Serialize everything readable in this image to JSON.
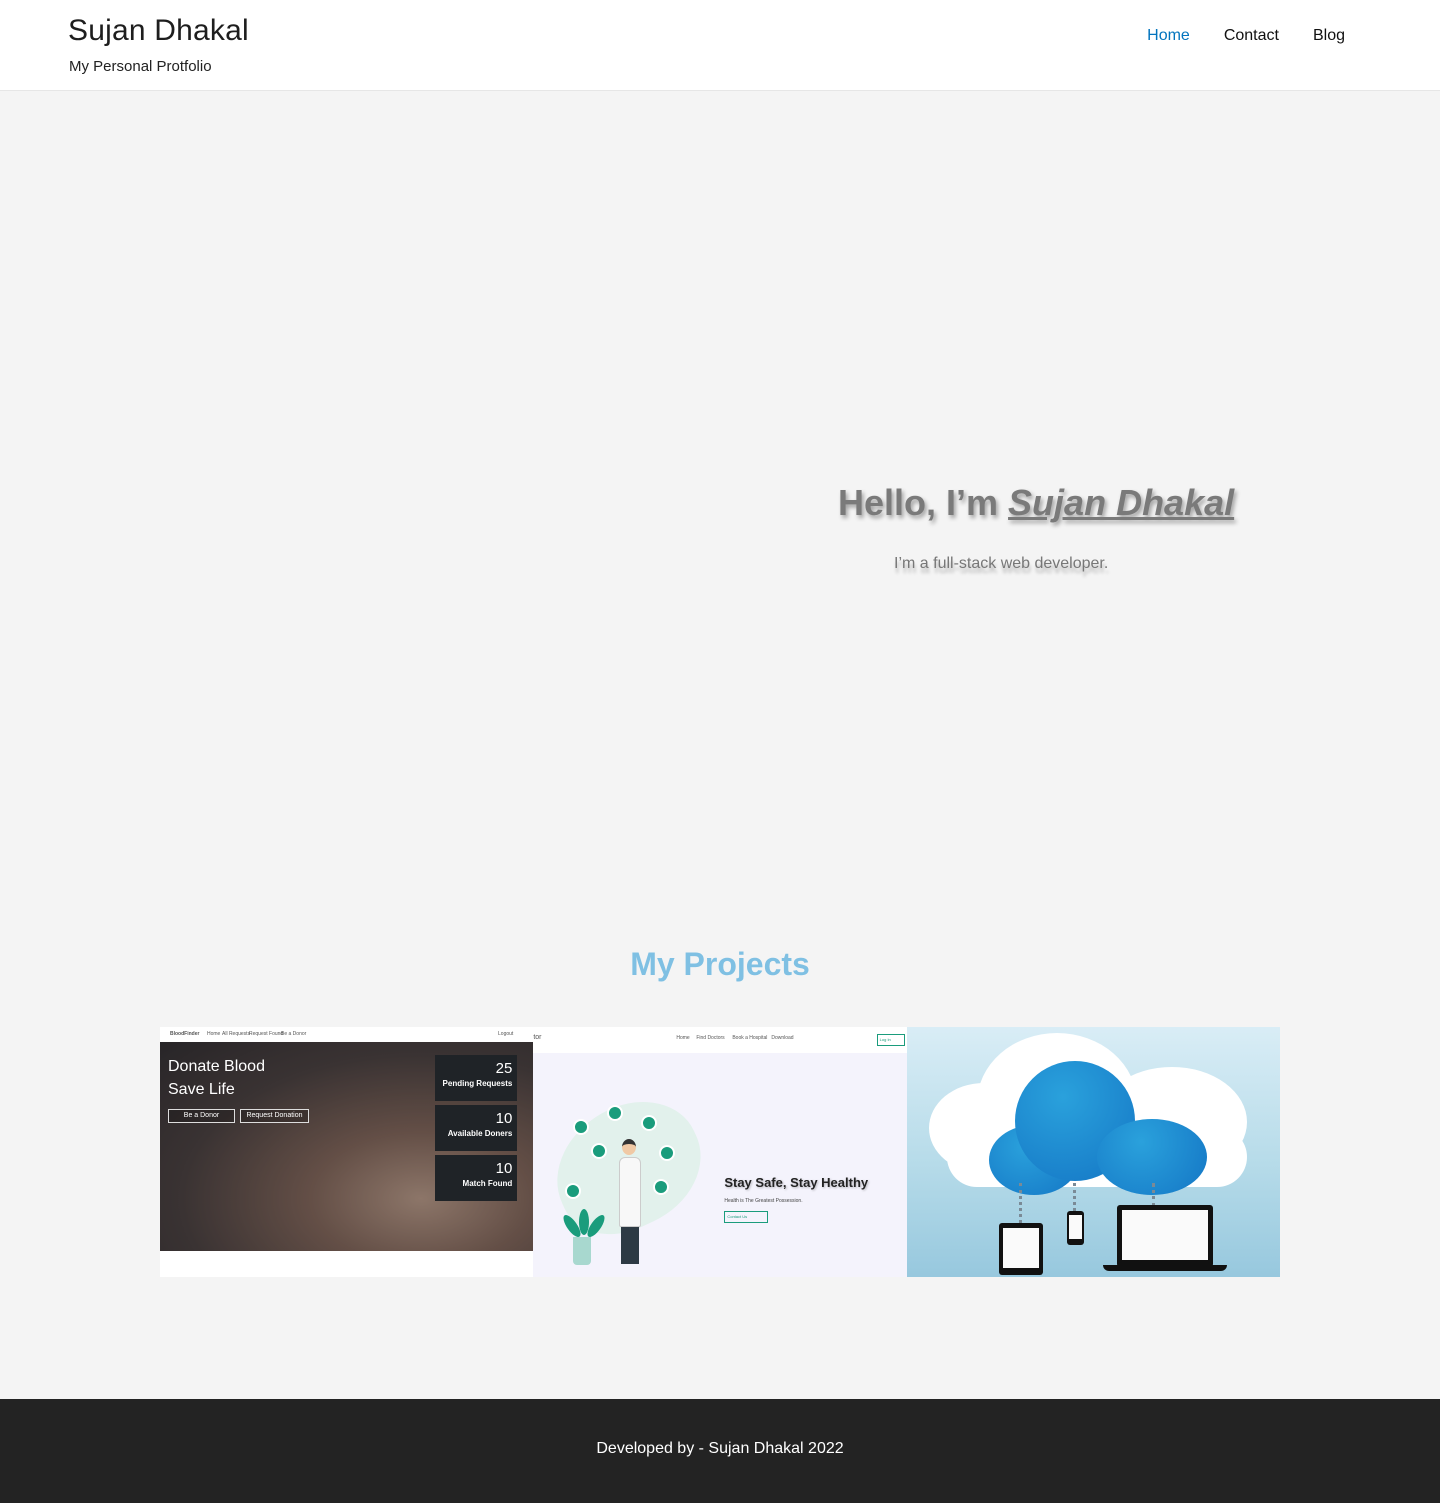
{
  "header": {
    "site_title": "Sujan Dhakal",
    "tagline": "My Personal Protfolio",
    "nav": [
      {
        "label": "Home",
        "active": true
      },
      {
        "label": "Contact",
        "active": false
      },
      {
        "label": "Blog",
        "active": false
      }
    ]
  },
  "hero": {
    "greeting": "Hello, I’m ",
    "name": "Sujan Dhakal",
    "subtitle": "I’m a full-stack web developer."
  },
  "projects": {
    "title": "My Projects",
    "items": [
      {
        "name": "blood-finder",
        "nav_brand": "BloodFinder",
        "nav_links": [
          "Home",
          "All Requests",
          "Request Found",
          "Be a Donor"
        ],
        "nav_right": "Logout",
        "headline_1": "Donate Blood",
        "headline_2": "Save Life",
        "buttons": [
          "Be a Donor",
          "Request Donation"
        ],
        "stats": [
          {
            "value": "25",
            "label": "Pending Requests"
          },
          {
            "value": "10",
            "label": "Available Doners"
          },
          {
            "value": "10",
            "label": "Match Found"
          }
        ]
      },
      {
        "name": "find-doctor",
        "nav_brand": "tor",
        "nav_links": [
          "Home",
          "Find Doctors",
          "Book a Hospital",
          "Download"
        ],
        "login": "Log In",
        "slogan": "Stay Safe, Stay Healthy",
        "small_text": "Health is The Greatest Possession.",
        "contact": "Contact Us"
      },
      {
        "name": "cloud-sync"
      }
    ]
  },
  "footer": {
    "text": "Developed by - Sujan Dhakal 2022"
  },
  "colors": {
    "nav_active": "#0274be",
    "projects_title": "#7fc0e3",
    "footer_bg": "#232323",
    "page_bg": "#f4f4f4"
  }
}
